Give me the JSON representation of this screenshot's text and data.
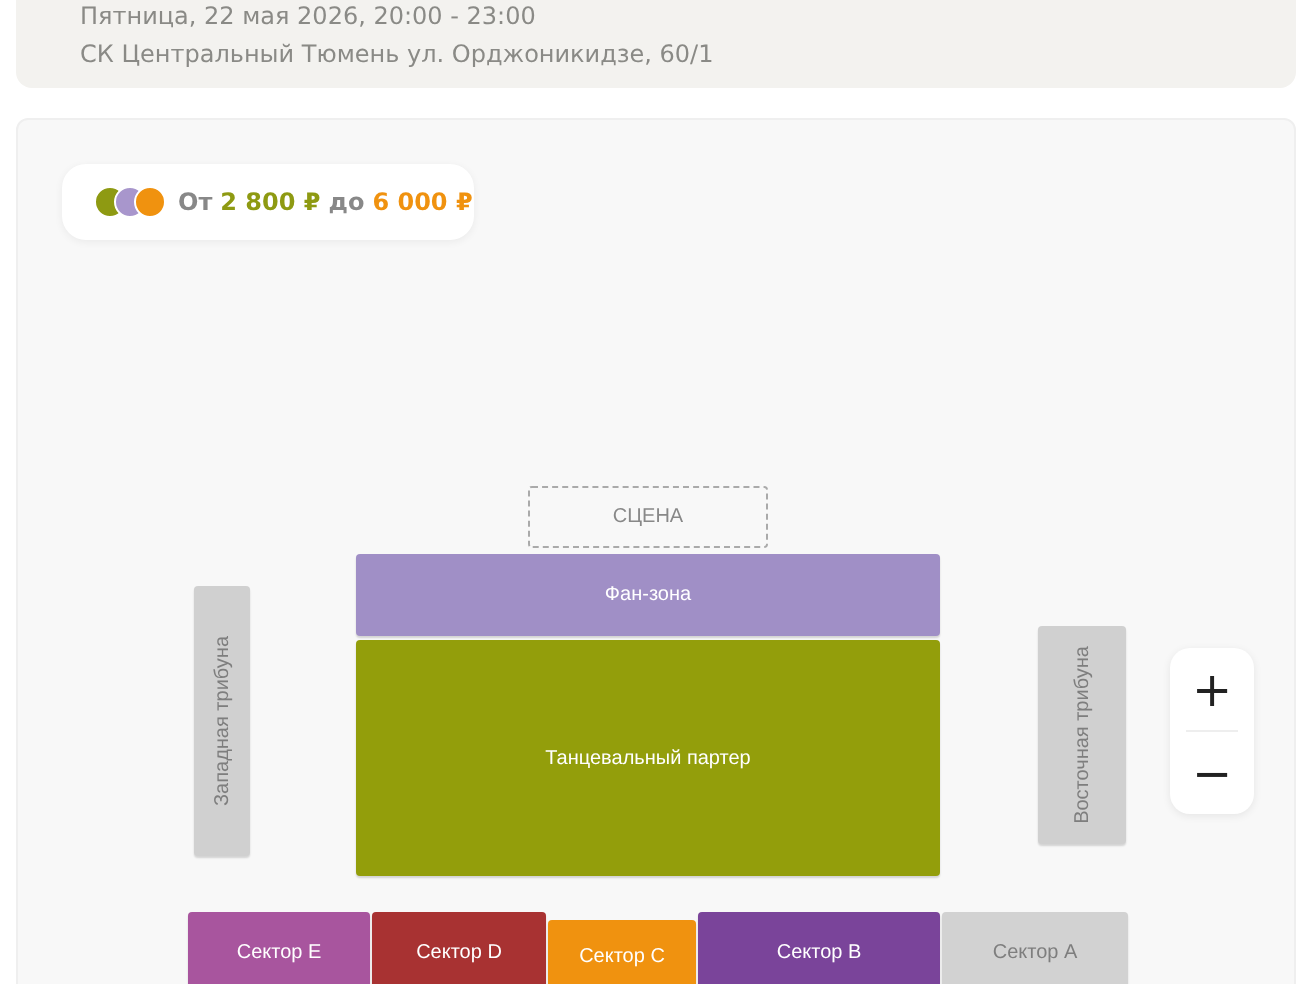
{
  "event": {
    "date": "Пятница, 22 мая 2026, 20:00 - 23:00",
    "venue": "СК Центральный Тюмень ул. Орджоникидзе, 60/1"
  },
  "price": {
    "dots": [
      {
        "color": "#8e9a12"
      },
      {
        "color": "#a896cc"
      },
      {
        "color": "#f0920f"
      }
    ],
    "from_label": "От",
    "min": "2 800 ₽",
    "to_label": "до",
    "max": "6 000 ₽"
  },
  "map": {
    "sections": [
      {
        "label": "СЦЕНА",
        "kind": "stage"
      },
      {
        "label": "Фан-зона",
        "kind": "zone",
        "color": "#a08fc6"
      },
      {
        "label": "Танцевальный партер",
        "kind": "zone",
        "color": "#939e0b"
      },
      {
        "label": "Западная трибуна",
        "kind": "vertical",
        "color": "#d0d0d0"
      },
      {
        "label": "Восточная трибуна",
        "kind": "vertical",
        "color": "#d0d0d0"
      },
      {
        "label": "Сектор E",
        "kind": "zone",
        "color": "#a8559e"
      },
      {
        "label": "Сектор D",
        "kind": "zone",
        "color": "#a83232"
      },
      {
        "label": "Сектор C",
        "kind": "zone",
        "color": "#f0920f"
      },
      {
        "label": "Сектор B",
        "kind": "zone",
        "color": "#7a449a"
      },
      {
        "label": "Сектор A",
        "kind": "zone",
        "color": "#d2d2d2"
      }
    ],
    "zoom": {
      "plus": "+",
      "minus": "−"
    }
  }
}
